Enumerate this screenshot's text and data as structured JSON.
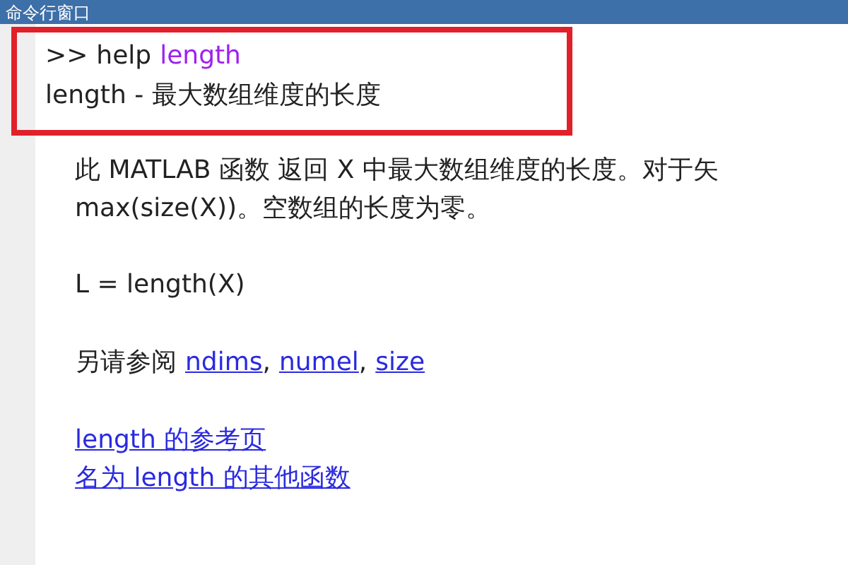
{
  "window": {
    "title": "命令行窗口"
  },
  "command": {
    "prompt": ">>",
    "verb": "help",
    "argument": "length"
  },
  "summary": "length - 最大数组维度的长度",
  "description_lines": [
    "此 MATLAB 函数 返回 X 中最大数组维度的长度。对于矢",
    "max(size(X))。空数组的长度为零。"
  ],
  "syntax": "L = length(X)",
  "see_also": {
    "label": "另请参阅",
    "separator": ",",
    "links": [
      "ndims",
      "numel",
      "size"
    ]
  },
  "reference_links": [
    "length 的参考页",
    "名为 length 的其他函数"
  ]
}
